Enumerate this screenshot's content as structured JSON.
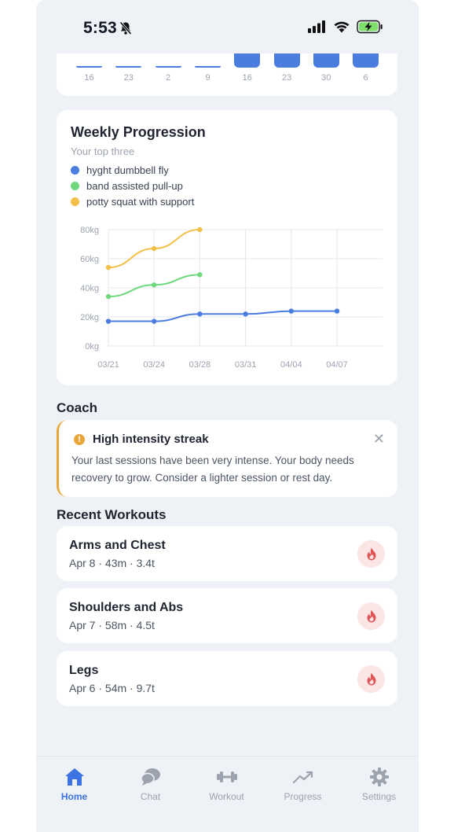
{
  "status_bar": {
    "time": "5:53"
  },
  "volume_chart": {
    "ticks": [
      "16",
      "23",
      "2",
      "9",
      "16",
      "23",
      "30",
      "6"
    ],
    "bar_levels": [
      0.05,
      0.05,
      0.05,
      0.05,
      1,
      1,
      1,
      1
    ]
  },
  "weekly_progression": {
    "title": "Weekly Progression",
    "subtitle": "Your top three",
    "legend": [
      {
        "label": "hyght dumbbell fly",
        "color": "#4a7ddf"
      },
      {
        "label": "band assisted pull-up",
        "color": "#6fd87d"
      },
      {
        "label": "potty squat with support",
        "color": "#f2c04a"
      }
    ]
  },
  "chart_data": {
    "type": "line",
    "x": [
      "03/21",
      "03/24",
      "03/28",
      "03/31",
      "04/04",
      "04/07"
    ],
    "ylim": [
      0,
      80
    ],
    "y_ticks": [
      "0kg",
      "20kg",
      "40kg",
      "60kg",
      "80kg"
    ],
    "grid": true,
    "series": [
      {
        "name": "hyght dumbbell fly",
        "color": "#4a7ddf",
        "values": [
          17,
          17,
          22,
          22,
          24,
          24
        ]
      },
      {
        "name": "band assisted pull-up",
        "color": "#6fd87d",
        "values": [
          34,
          42,
          49
        ]
      },
      {
        "name": "potty squat with support",
        "color": "#f2c04a",
        "values": [
          54,
          67,
          80
        ]
      }
    ]
  },
  "coach": {
    "section_title": "Coach",
    "alert_title": "High intensity streak",
    "alert_body": "Your last sessions have been very intense. Your body needs recovery to grow. Consider a lighter session or rest day.",
    "close_icon": "close-icon"
  },
  "recent_workouts": {
    "section_title": "Recent Workouts",
    "items": [
      {
        "name": "Arms and Chest",
        "meta": "Apr 8 · 43m · 3.4t"
      },
      {
        "name": "Shoulders and Abs",
        "meta": "Apr 7 · 58m · 4.5t"
      },
      {
        "name": "Legs",
        "meta": "Apr 6 · 54m · 9.7t"
      }
    ]
  },
  "tab_bar": {
    "tabs": [
      {
        "label": "Home",
        "icon": "home-icon",
        "active": true
      },
      {
        "label": "Chat",
        "icon": "chat-icon",
        "active": false
      },
      {
        "label": "Workout",
        "icon": "dumbbell-icon",
        "active": false
      },
      {
        "label": "Progress",
        "icon": "trend-icon",
        "active": false
      },
      {
        "label": "Settings",
        "icon": "gear-icon",
        "active": false
      }
    ]
  },
  "colors": {
    "accent": "#3b73e3",
    "warning": "#e9a73b",
    "flame": "#e05555"
  }
}
